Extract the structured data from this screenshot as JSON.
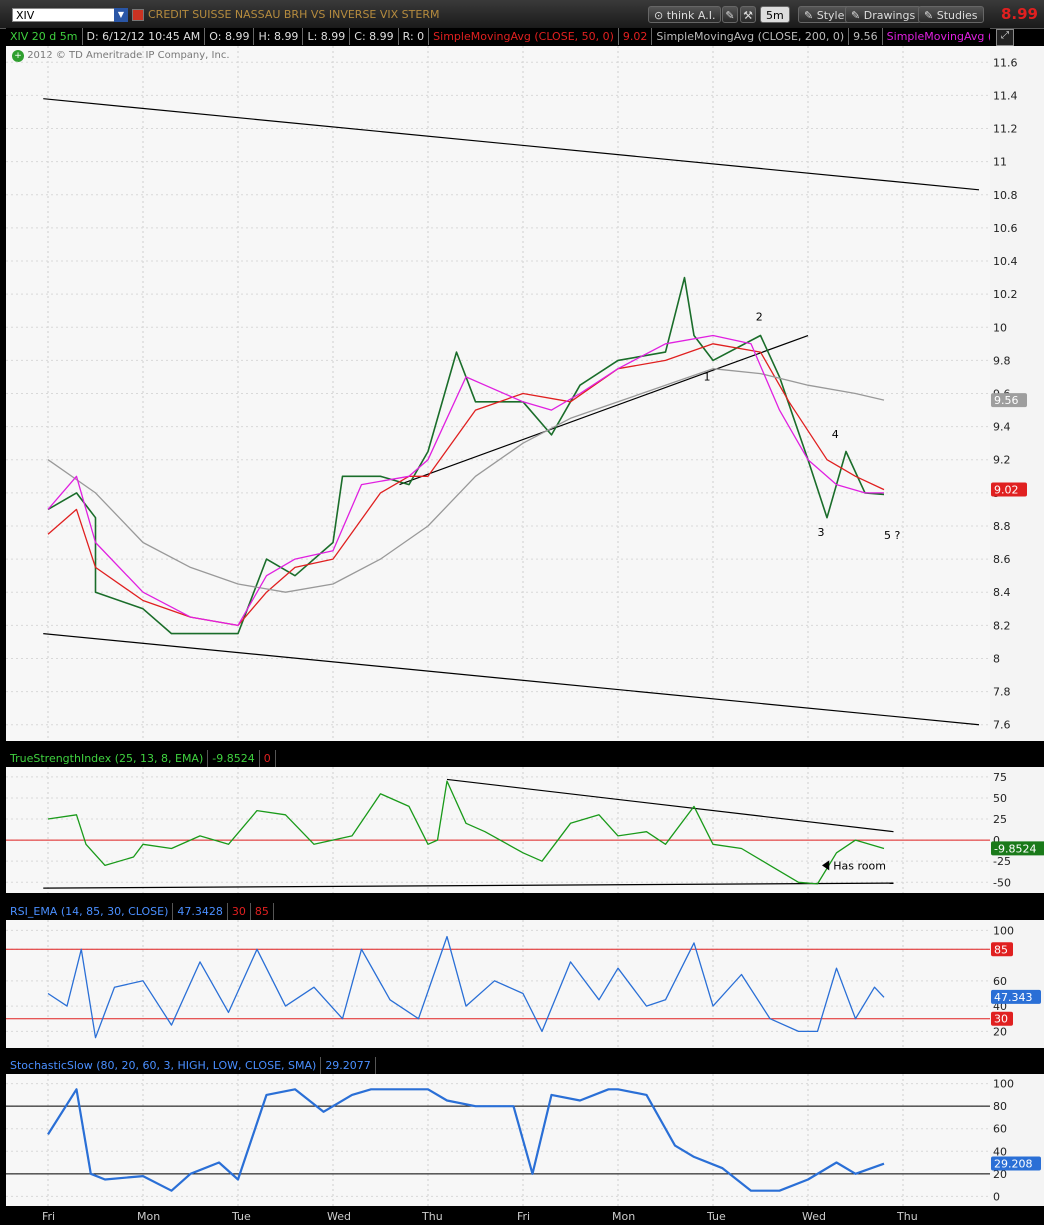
{
  "toolbar": {
    "symbol": "XIV",
    "title": "CREDIT SUISSE NASSAU BRH VS INVERSE VIX STERM",
    "think": "think A.I.",
    "interval": "5m",
    "style": "Style",
    "drawings": "Drawings",
    "studies": "Studies",
    "last_price": "8.99",
    "colors": {
      "last_price": "#e02020",
      "title": "#b58b3e"
    }
  },
  "info_bar": {
    "symbol_period": "XIV 20 d 5m",
    "date": "D: 6/12/12 10:45 AM",
    "open": "O: 8.99",
    "high": "H: 8.99",
    "low": "L: 8.99",
    "close": "C: 8.99",
    "range": "R: 0",
    "sma50": "SimpleMovingAvg (CLOSE, 50, 0)",
    "sma50_value": "9.02",
    "sma200": "SimpleMovingAvg (CLOSE, 200, 0)",
    "sma200_value": "9.56",
    "sma3": "SimpleMovingAvg (CL",
    "copyright": "2012 © TD Ameritrade IP Company, Inc."
  },
  "chart_data": [
    {
      "type": "line",
      "name": "price",
      "ylim": [
        7.55,
        11.65
      ],
      "yticks": [
        "11.6",
        "11.4",
        "11.2",
        "11",
        "10.8",
        "10.6",
        "10.4",
        "10.2",
        "10",
        "9.8",
        "9.6",
        "9.4",
        "9.2",
        "9",
        "8.8",
        "8.6",
        "8.4",
        "8.2",
        "8",
        "7.8",
        "7.6"
      ],
      "x": [
        "Fri",
        "Mon",
        "Tue",
        "Wed",
        "Thu",
        "Fri",
        "Mon",
        "Tue",
        "Wed",
        "Thu"
      ],
      "series": [
        {
          "name": "XIV 5m close",
          "color": "#1a6d2a",
          "values": [
            [
              0,
              8.9
            ],
            [
              0.3,
              9.0
            ],
            [
              0.5,
              8.85
            ],
            [
              0.5,
              8.4
            ],
            [
              1.0,
              8.3
            ],
            [
              1.3,
              8.15
            ],
            [
              2.0,
              8.15
            ],
            [
              2.3,
              8.6
            ],
            [
              2.6,
              8.5
            ],
            [
              3.0,
              8.7
            ],
            [
              3.1,
              9.1
            ],
            [
              3.5,
              9.1
            ],
            [
              3.8,
              9.05
            ],
            [
              4.0,
              9.25
            ],
            [
              4.3,
              9.85
            ],
            [
              4.5,
              9.55
            ],
            [
              5.0,
              9.55
            ],
            [
              5.3,
              9.35
            ],
            [
              5.6,
              9.65
            ],
            [
              6.0,
              9.8
            ],
            [
              6.5,
              9.85
            ],
            [
              6.7,
              10.3
            ],
            [
              6.8,
              9.95
            ],
            [
              7.0,
              9.8
            ],
            [
              7.5,
              9.95
            ],
            [
              7.7,
              9.7
            ],
            [
              8.0,
              9.2
            ],
            [
              8.2,
              8.85
            ],
            [
              8.4,
              9.25
            ],
            [
              8.6,
              9.0
            ],
            [
              8.8,
              8.99
            ]
          ]
        },
        {
          "name": "SimpleMovingAvg (CLOSE, 50, 0)",
          "color": "#e02020",
          "values": [
            [
              0,
              8.75
            ],
            [
              0.3,
              8.9
            ],
            [
              0.5,
              8.55
            ],
            [
              1.0,
              8.35
            ],
            [
              1.5,
              8.25
            ],
            [
              2.0,
              8.2
            ],
            [
              2.3,
              8.4
            ],
            [
              2.6,
              8.55
            ],
            [
              3.0,
              8.6
            ],
            [
              3.5,
              9.0
            ],
            [
              3.8,
              9.1
            ],
            [
              4.0,
              9.1
            ],
            [
              4.5,
              9.5
            ],
            [
              5.0,
              9.6
            ],
            [
              5.5,
              9.55
            ],
            [
              6.0,
              9.75
            ],
            [
              6.5,
              9.8
            ],
            [
              7.0,
              9.9
            ],
            [
              7.5,
              9.85
            ],
            [
              7.8,
              9.55
            ],
            [
              8.2,
              9.2
            ],
            [
              8.5,
              9.1
            ],
            [
              8.8,
              9.02
            ]
          ]
        },
        {
          "name": "SimpleMovingAvg (CLOSE, 200, 0)",
          "color": "#999999",
          "values": [
            [
              0,
              9.2
            ],
            [
              0.5,
              9.0
            ],
            [
              1.0,
              8.7
            ],
            [
              1.5,
              8.55
            ],
            [
              2.0,
              8.45
            ],
            [
              2.5,
              8.4
            ],
            [
              3.0,
              8.45
            ],
            [
              3.5,
              8.6
            ],
            [
              4.0,
              8.8
            ],
            [
              4.5,
              9.1
            ],
            [
              5.0,
              9.3
            ],
            [
              5.5,
              9.45
            ],
            [
              6.0,
              9.55
            ],
            [
              6.5,
              9.65
            ],
            [
              7.0,
              9.75
            ],
            [
              7.5,
              9.72
            ],
            [
              8.0,
              9.65
            ],
            [
              8.5,
              9.6
            ],
            [
              8.8,
              9.56
            ]
          ]
        },
        {
          "name": "SimpleMovingAvg (CL",
          "color": "#e020e0",
          "values": [
            [
              0,
              8.9
            ],
            [
              0.3,
              9.1
            ],
            [
              0.5,
              8.7
            ],
            [
              1.0,
              8.4
            ],
            [
              1.5,
              8.25
            ],
            [
              2.0,
              8.2
            ],
            [
              2.3,
              8.5
            ],
            [
              2.6,
              8.6
            ],
            [
              3.0,
              8.65
            ],
            [
              3.3,
              9.05
            ],
            [
              3.8,
              9.1
            ],
            [
              4.0,
              9.2
            ],
            [
              4.4,
              9.7
            ],
            [
              5.0,
              9.55
            ],
            [
              5.3,
              9.5
            ],
            [
              5.6,
              9.6
            ],
            [
              6.0,
              9.75
            ],
            [
              6.5,
              9.9
            ],
            [
              7.0,
              9.95
            ],
            [
              7.4,
              9.9
            ],
            [
              7.7,
              9.5
            ],
            [
              8.0,
              9.2
            ],
            [
              8.3,
              9.05
            ],
            [
              8.6,
              9.0
            ],
            [
              8.8,
              9.0
            ]
          ]
        }
      ],
      "trendlines": [
        {
          "from": [
            -0.05,
            11.38
          ],
          "to": [
            9.8,
            10.83
          ]
        },
        {
          "from": [
            -0.05,
            8.15
          ],
          "to": [
            9.8,
            7.6
          ]
        },
        {
          "from": [
            3.7,
            9.05
          ],
          "to": [
            8.0,
            9.95
          ]
        }
      ],
      "badges": [
        {
          "value": "9.56",
          "bg": "#9e9e9e",
          "fg": "#fff"
        },
        {
          "value": "9.02",
          "bg": "#e02020",
          "fg": "#fff"
        }
      ],
      "annotations": [
        {
          "text": "1",
          "x": 6.9,
          "y": 9.68
        },
        {
          "text": "2",
          "x": 7.45,
          "y": 10.04
        },
        {
          "text": "3",
          "x": 8.1,
          "y": 8.74
        },
        {
          "text": "4",
          "x": 8.25,
          "y": 9.33
        },
        {
          "text": "5 ?",
          "x": 8.8,
          "y": 8.72
        }
      ]
    },
    {
      "type": "line",
      "name": "tsi",
      "label": "TrueStrengthIndex (25, 13, 8, EMA)",
      "label_value": "-9.8524",
      "label_extra": "0",
      "ylim": [
        -58,
        82
      ],
      "yticks": [
        "75",
        "50",
        "25",
        "0",
        "-25",
        "-50"
      ],
      "hlines": [
        {
          "value": 0,
          "color": "#e02020"
        }
      ],
      "series": [
        {
          "name": "TSI",
          "color": "#1a9a1a",
          "values": [
            [
              0,
              25
            ],
            [
              0.3,
              30
            ],
            [
              0.4,
              -5
            ],
            [
              0.6,
              -30
            ],
            [
              0.9,
              -20
            ],
            [
              1.0,
              -5
            ],
            [
              1.3,
              -10
            ],
            [
              1.6,
              5
            ],
            [
              1.9,
              -5
            ],
            [
              2.2,
              35
            ],
            [
              2.5,
              30
            ],
            [
              2.8,
              -5
            ],
            [
              3.2,
              5
            ],
            [
              3.5,
              55
            ],
            [
              3.8,
              40
            ],
            [
              4.0,
              -5
            ],
            [
              4.1,
              0
            ],
            [
              4.2,
              70
            ],
            [
              4.4,
              20
            ],
            [
              4.6,
              10
            ],
            [
              5.0,
              -15
            ],
            [
              5.2,
              -25
            ],
            [
              5.5,
              20
            ],
            [
              5.8,
              30
            ],
            [
              6.0,
              5
            ],
            [
              6.3,
              10
            ],
            [
              6.5,
              -5
            ],
            [
              6.8,
              40
            ],
            [
              7.0,
              -5
            ],
            [
              7.3,
              -10
            ],
            [
              7.6,
              -30
            ],
            [
              7.9,
              -50
            ],
            [
              8.1,
              -52
            ],
            [
              8.3,
              -15
            ],
            [
              8.5,
              0
            ],
            [
              8.8,
              -10
            ]
          ]
        }
      ],
      "trendlines": [
        {
          "from": [
            4.2,
            72
          ],
          "to": [
            8.9,
            10
          ]
        },
        {
          "from": [
            -0.05,
            -57
          ],
          "to": [
            8.9,
            -51
          ]
        }
      ],
      "annotation": "Has room",
      "badge": {
        "value": "-9.8524",
        "bg": "#1a7a1a",
        "fg": "#fff"
      }
    },
    {
      "type": "line",
      "name": "rsi",
      "label": "RSI_EMA (14, 85, 30, CLOSE)",
      "label_value": "47.3428",
      "label_levels": [
        "30",
        "85"
      ],
      "ylim": [
        10,
        105
      ],
      "yticks": [
        "100",
        "85",
        "60",
        "40",
        "20"
      ],
      "hlines": [
        {
          "value": 85,
          "color": "#e02020"
        },
        {
          "value": 30,
          "color": "#e02020"
        }
      ],
      "series": [
        {
          "name": "RSI",
          "color": "#2a6fd6",
          "values": [
            [
              0,
              50
            ],
            [
              0.2,
              40
            ],
            [
              0.35,
              85
            ],
            [
              0.5,
              15
            ],
            [
              0.7,
              55
            ],
            [
              1.0,
              60
            ],
            [
              1.3,
              25
            ],
            [
              1.6,
              75
            ],
            [
              1.9,
              35
            ],
            [
              2.2,
              85
            ],
            [
              2.5,
              40
            ],
            [
              2.8,
              55
            ],
            [
              3.1,
              30
            ],
            [
              3.3,
              85
            ],
            [
              3.6,
              45
            ],
            [
              3.9,
              30
            ],
            [
              4.2,
              95
            ],
            [
              4.4,
              40
            ],
            [
              4.7,
              60
            ],
            [
              5.0,
              50
            ],
            [
              5.2,
              20
            ],
            [
              5.5,
              75
            ],
            [
              5.8,
              45
            ],
            [
              6.0,
              70
            ],
            [
              6.3,
              40
            ],
            [
              6.5,
              45
            ],
            [
              6.8,
              90
            ],
            [
              7.0,
              40
            ],
            [
              7.3,
              65
            ],
            [
              7.6,
              30
            ],
            [
              7.9,
              20
            ],
            [
              8.1,
              20
            ],
            [
              8.3,
              70
            ],
            [
              8.5,
              30
            ],
            [
              8.7,
              55
            ],
            [
              8.8,
              47
            ]
          ]
        }
      ],
      "badges": [
        {
          "value": "85",
          "bg": "#e02020",
          "fg": "#fff"
        },
        {
          "value": "47.343",
          "bg": "#2a6fd6",
          "fg": "#fff"
        },
        {
          "value": "30",
          "bg": "#e02020",
          "fg": "#fff"
        }
      ]
    },
    {
      "type": "line",
      "name": "stoch",
      "label": "StochasticSlow (80, 20, 60, 3, HIGH, LOW, CLOSE, SMA)",
      "label_value": "29.2077",
      "ylim": [
        -5,
        105
      ],
      "yticks": [
        "100",
        "80",
        "60",
        "40",
        "20",
        "0"
      ],
      "hlines": [
        {
          "value": 80,
          "color": "#000"
        },
        {
          "value": 20,
          "color": "#000"
        }
      ],
      "series": [
        {
          "name": "%K",
          "color": "#2a6fd6",
          "values": [
            [
              0,
              55
            ],
            [
              0.3,
              95
            ],
            [
              0.45,
              20
            ],
            [
              0.6,
              15
            ],
            [
              1.0,
              18
            ],
            [
              1.3,
              5
            ],
            [
              1.5,
              20
            ],
            [
              1.8,
              30
            ],
            [
              2.0,
              15
            ],
            [
              2.3,
              90
            ],
            [
              2.6,
              95
            ],
            [
              2.9,
              75
            ],
            [
              3.2,
              90
            ],
            [
              3.4,
              95
            ],
            [
              3.7,
              95
            ],
            [
              4.0,
              95
            ],
            [
              4.2,
              85
            ],
            [
              4.5,
              80
            ],
            [
              4.9,
              80
            ],
            [
              5.1,
              20
            ],
            [
              5.3,
              90
            ],
            [
              5.6,
              85
            ],
            [
              5.9,
              95
            ],
            [
              6.0,
              95
            ],
            [
              6.3,
              90
            ],
            [
              6.6,
              45
            ],
            [
              6.8,
              35
            ],
            [
              7.1,
              25
            ],
            [
              7.4,
              5
            ],
            [
              7.7,
              5
            ],
            [
              8.0,
              15
            ],
            [
              8.3,
              30
            ],
            [
              8.5,
              20
            ],
            [
              8.8,
              29
            ]
          ]
        }
      ],
      "badge": {
        "value": "29.208",
        "bg": "#2a6fd6",
        "fg": "#fff"
      }
    }
  ]
}
